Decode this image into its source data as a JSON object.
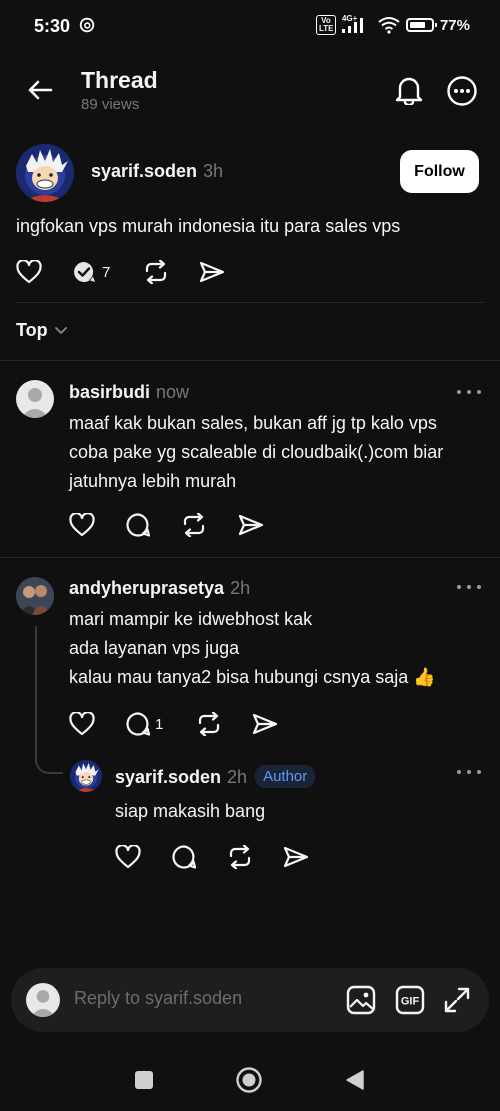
{
  "status_bar": {
    "time": "5:30",
    "volte": "Vo LTE",
    "network": "4G+",
    "battery_percent": "77%",
    "battery_level": 0.77
  },
  "header": {
    "title": "Thread",
    "views": "89 views"
  },
  "original_post": {
    "username": "syarif.soden",
    "time": "3h",
    "follow_label": "Follow",
    "text": "ingfokan vps murah indonesia itu para sales vps",
    "reply_count": "7"
  },
  "sort": {
    "label": "Top"
  },
  "replies": [
    {
      "username": "basirbudi",
      "time": "now",
      "text": "maaf kak bukan sales, bukan aff jg tp kalo vps\ncoba pake yg scaleable di cloudbaik(.)com biar\njatuhnya lebih murah"
    },
    {
      "username": "andyheruprasetya",
      "time": "2h",
      "text": "mari mampir ke idwebhost kak\nada layanan vps juga\nkalau mau tanya2 bisa hubungi csnya saja 👍",
      "reply_count": "1"
    },
    {
      "username": "syarif.soden",
      "time": "2h",
      "badge": "Author",
      "text": "siap makasih bang"
    }
  ],
  "reply_bar": {
    "placeholder": "Reply to syarif.soden",
    "gif_label": "GIF"
  },
  "colors": {
    "background": "#101010",
    "text": "#f3f5f7",
    "muted": "#777777",
    "author_badge_text": "#5b9bf5",
    "author_badge_bg": "#1a2436"
  }
}
